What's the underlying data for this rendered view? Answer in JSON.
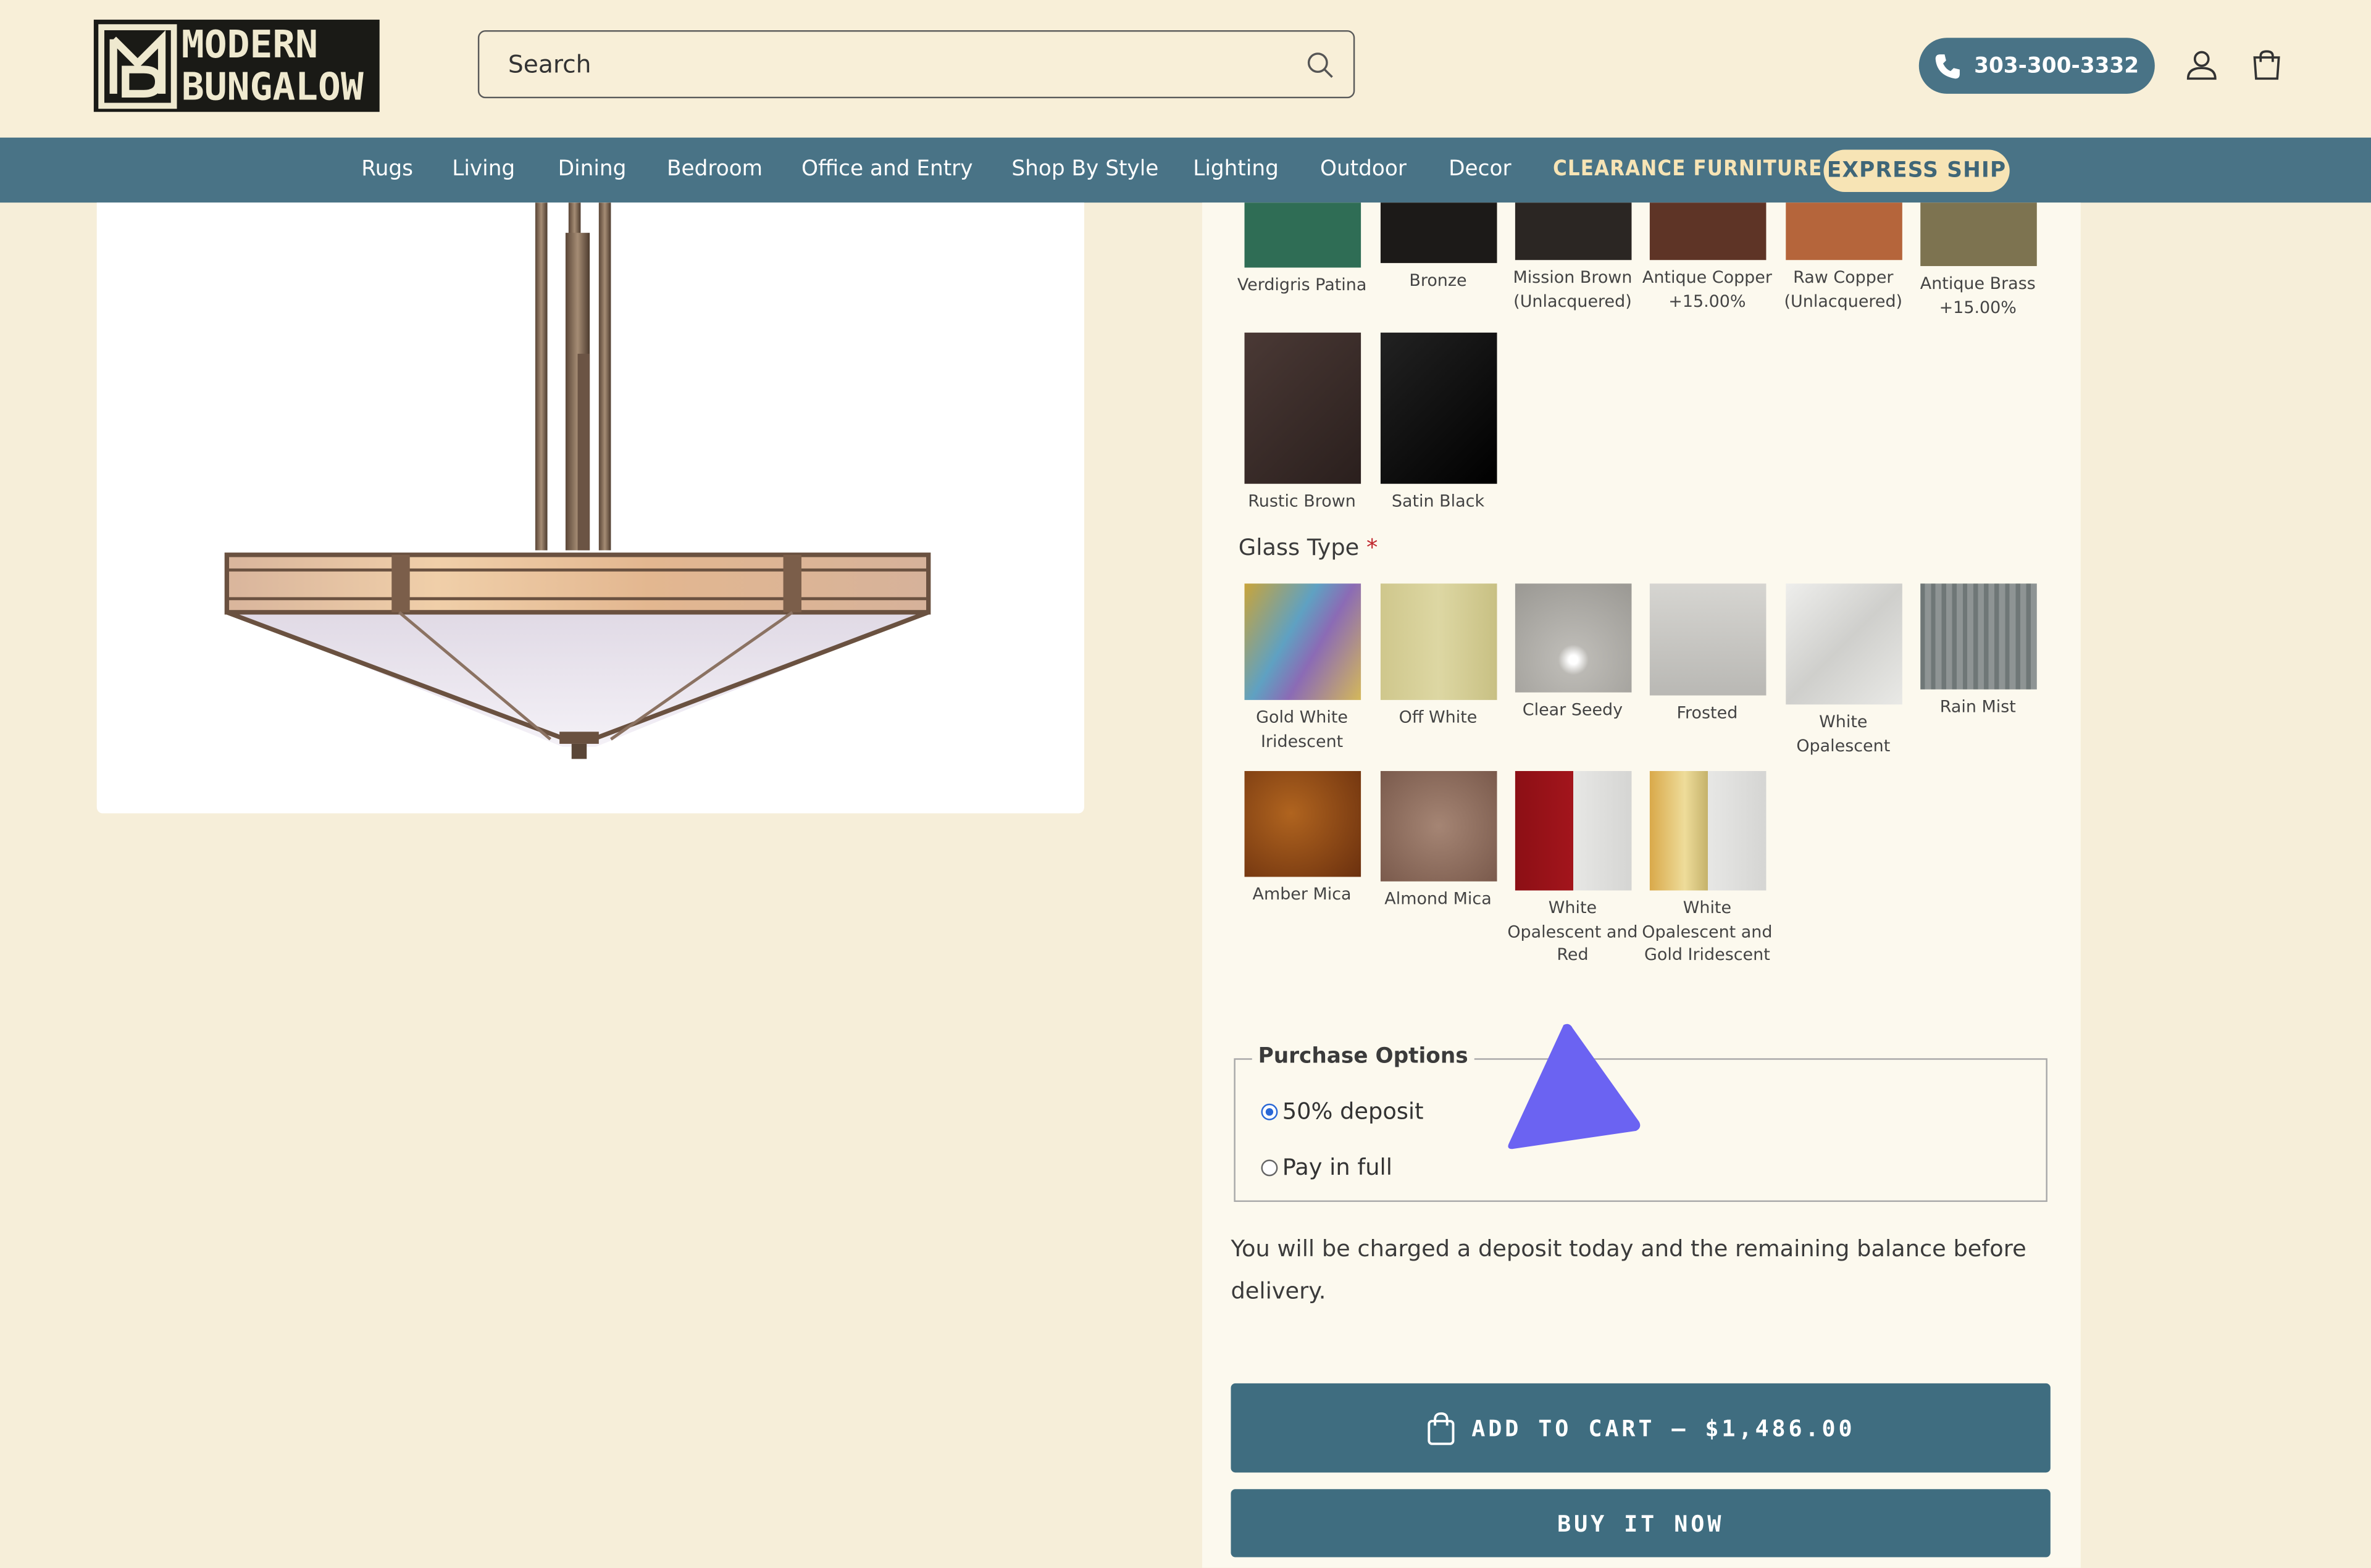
{
  "brand": {
    "logo_line1": "MODERN",
    "logo_line2": "BUNGALOW"
  },
  "search": {
    "placeholder": "Search"
  },
  "header": {
    "phone": "303-300-3332"
  },
  "nav": {
    "items": [
      "Rugs",
      "Living",
      "Dining",
      "Bedroom",
      "Office and Entry",
      "Shop By Style",
      "Lighting",
      "Outdoor",
      "Decor"
    ],
    "clearance": "CLEARANCE FURNITURE",
    "express": "EXPRESS SHIP"
  },
  "finish": {
    "swatches": [
      {
        "label": "Verdigris Patina",
        "color": "#2f6d55"
      },
      {
        "label": "Bronze",
        "color": "#1c1a18"
      },
      {
        "label": "Mission Brown (Unlacquered)",
        "color": "#2b2623"
      },
      {
        "label": "Antique Copper +15.00%",
        "color": "#5e3426"
      },
      {
        "label": "Raw Copper (Unlacquered)",
        "color": "#b5653b"
      },
      {
        "label": "Antique Brass +15.00%",
        "color": "#7d7350"
      },
      {
        "label": "Rustic Brown",
        "color": "#3a2c28"
      },
      {
        "label": "Satin Black",
        "color": "#0d0d0d"
      }
    ]
  },
  "glass": {
    "label": "Glass Type",
    "required_mark": "*",
    "swatches": [
      {
        "label": "Gold White Iridescent",
        "color": "#7fa6b0"
      },
      {
        "label": "Off White",
        "color": "#d3cd95"
      },
      {
        "label": "Clear Seedy",
        "color": "#a9a7a2"
      },
      {
        "label": "Frosted",
        "color": "#c8c7c3"
      },
      {
        "label": "White Opalescent",
        "color": "#dddcd8"
      },
      {
        "label": "Rain Mist",
        "color": "#7a8181"
      },
      {
        "label": "Amber Mica",
        "color": "#8a4316"
      },
      {
        "label": "Almond Mica",
        "color": "#8f6f5f"
      },
      {
        "label": "White Opalescent and Red",
        "color": "#8c0f15"
      },
      {
        "label": "White Opalescent and Gold Iridescent",
        "color": "#e0c58c"
      }
    ]
  },
  "purchase": {
    "legend": "Purchase Options",
    "options": [
      {
        "label": "50% deposit",
        "selected": true
      },
      {
        "label": "Pay in full",
        "selected": false
      }
    ],
    "note": "You will be charged a deposit today and the remaining balance before delivery."
  },
  "actions": {
    "add_to_cart": "ADD TO CART – $1,486.00",
    "buy_now": "BUY IT NOW"
  }
}
